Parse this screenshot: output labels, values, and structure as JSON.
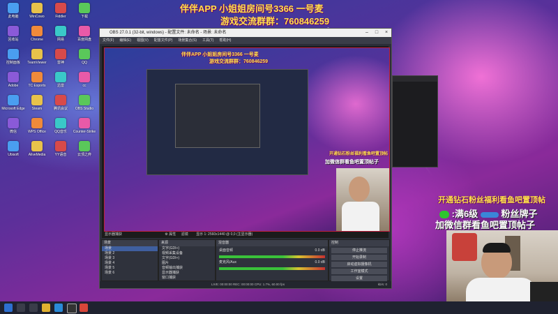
{
  "overlay": {
    "header_line1": "伴伴APP 小姐姐房间号3366 一号麦",
    "header_line2": "游戏交流群群：760846259",
    "promo_line1": "开通钻石粉丝福利看鱼吧置顶帖",
    "promo_line2": ":满6级",
    "promo_badge": "粉丝牌子",
    "promo_line3": "加微信群看鱼吧置顶帖子"
  },
  "desktop_icons": [
    {
      "label": "此电脑"
    },
    {
      "label": "WinCowo"
    },
    {
      "label": "Fiddler"
    },
    {
      "label": "下载"
    },
    {
      "label": "回收站"
    },
    {
      "label": "Chrome"
    },
    {
      "label": "网易"
    },
    {
      "label": "百度网盘"
    },
    {
      "label": "控制面板"
    },
    {
      "label": "TeamViewer"
    },
    {
      "label": "雷神"
    },
    {
      "label": "QQ"
    },
    {
      "label": "Adobe"
    },
    {
      "label": "TC Exports"
    },
    {
      "label": "迅雷"
    },
    {
      "label": "cc"
    },
    {
      "label": "Microsoft Edge"
    },
    {
      "label": "Steam"
    },
    {
      "label": "腾讯会议"
    },
    {
      "label": "OBS Studio"
    },
    {
      "label": "微信"
    },
    {
      "label": "WPS Office"
    },
    {
      "label": "QQ音乐"
    },
    {
      "label": "Counter-Strike"
    },
    {
      "label": "Ubisoft"
    },
    {
      "label": "AliveMedia"
    },
    {
      "label": "YY语音"
    },
    {
      "label": "云顶之弈"
    }
  ],
  "obs": {
    "title": "OBS 27.0.1 (32-bit, windows) - 配置文件: 未命名 - 场景: 未命名",
    "menu": [
      "文件(F)",
      "编辑(E)",
      "视图(V)",
      "配置文件(P)",
      "场景集合(S)",
      "工具(T)",
      "帮助(H)"
    ],
    "source_bar": "显示器捕获",
    "props_label": "属性",
    "filters_label": "滤镜",
    "display_label": "显示 1: 2560x1440 @ 0,0 (主显示器)",
    "panels": {
      "scenes": "场景",
      "sources": "来源",
      "mixer": "混音器",
      "transitions": "转场特效",
      "controls": "控制"
    },
    "scenes": [
      "场景",
      "场景 2",
      "场景 3",
      "场景 4",
      "场景 5",
      "场景 6"
    ],
    "sources": [
      "文字(GDI+)",
      "视频采集设备",
      "文字(GDI+)",
      "图片",
      "音频输出捕获",
      "显示器捕获",
      "窗口捕获"
    ],
    "mixer": [
      {
        "name": "桌面音频",
        "level": "0.0 dB"
      },
      {
        "name": "麦克风/Aux",
        "level": "0.0 dB"
      }
    ],
    "controls": [
      "停止推流",
      "开始录制",
      "启动虚拟摄像机",
      "工作室模式",
      "设置",
      "退出"
    ],
    "status": "LIVE: 00:00:00   REC: 00:00:00   CPU: 1.7%, 60.00 fps",
    "fps_label": "kb/s: 0"
  },
  "taskbar": {
    "search_icon": "search-icon",
    "time": "",
    "items": [
      "start-icon",
      "search-icon",
      "taskview-icon",
      "explorer-icon",
      "edge-icon",
      "obs-icon",
      "chrome-icon"
    ]
  },
  "colors": {
    "header_yellow": "#ffe24a",
    "obs_bg": "#2b2e38",
    "live_red": "#c0203c"
  }
}
